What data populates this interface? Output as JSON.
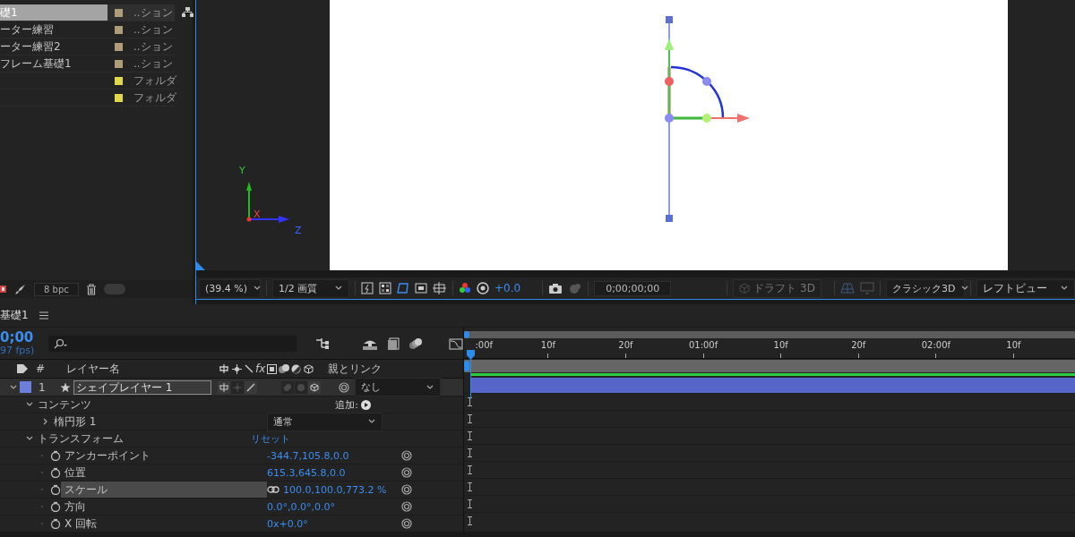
{
  "project": {
    "items": [
      {
        "name": "礎1",
        "type": "..ション",
        "color": "#b09c78",
        "selected": true
      },
      {
        "name": "ーター練習",
        "type": "..ション",
        "color": "#b09c78",
        "selected": false
      },
      {
        "name": "ーター練習2",
        "type": "..ション",
        "color": "#b09c78",
        "selected": false
      },
      {
        "name": "フレーム基礎1",
        "type": "..ション",
        "color": "#b09c78",
        "selected": false
      },
      {
        "type": "フォルダ",
        "color": "#e3d84a",
        "selected": false
      },
      {
        "type": "フォルダ",
        "color": "#e3d84a",
        "selected": false
      }
    ],
    "bit_depth": "8 bpc",
    "toggle_on": false
  },
  "viewer": {
    "axis_labels": [
      "Y",
      "X",
      "Z"
    ],
    "toolbar": {
      "zoom": "(39.4 %)",
      "resolution": "1/2 画質",
      "exposure": "+0.0",
      "timecode": "0;00;00;00",
      "draft_3d": {
        "label": "ドラフト 3D",
        "disabled": true
      },
      "renderer": "クラシック3D",
      "view": "レフトビュー"
    }
  },
  "timeline": {
    "tab": "基礎1",
    "current_time": "0;00",
    "fps": "97 fps)",
    "columns": {
      "number": "#",
      "layer_name": "レイヤー名",
      "fx": "fx",
      "parent": "親とリンク"
    },
    "layer": {
      "number": "1",
      "name": "シェイプレイヤー 1",
      "color": "#6b7fdb",
      "expanded": true,
      "parent": "なし",
      "switches": [
        {
          "kind": "shy",
          "on": true
        },
        {
          "kind": "collapse",
          "on": false
        },
        {
          "kind": "quality",
          "on": true
        },
        {
          "kind": "motion_blur",
          "on": false
        },
        {
          "kind": "adjustment",
          "on": false
        },
        {
          "kind": "cube",
          "on": true
        }
      ]
    },
    "properties": [
      {
        "name": "コンテンツ",
        "expanded": true,
        "add_label": "追加:",
        "children": [
          {
            "name": "楕円形 1",
            "expanded": false,
            "blend_mode": "通常"
          }
        ]
      },
      {
        "name": "トランスフォーム",
        "expanded": true,
        "reset_label": "リセット",
        "children": [
          {
            "name": "アンカーポイント",
            "value": "-344.7,105.8,0.0",
            "selected": false,
            "linked": false
          },
          {
            "name": "位置",
            "value": "615.3,645.8,0.0",
            "selected": false,
            "linked": false
          },
          {
            "name": "スケール",
            "value": "100.0,100.0,773.2 %",
            "selected": true,
            "linked": true
          },
          {
            "name": "方向",
            "value": "0.0°,0.0°,0.0°",
            "selected": false,
            "linked": false
          },
          {
            "name": "X 回転",
            "value": "0x+0.0°",
            "selected": false,
            "linked": false
          }
        ]
      }
    ],
    "ruler": [
      ":00f",
      "10f",
      "20f",
      "01:00f",
      "10f",
      "20f",
      "02:00f",
      "10f"
    ]
  }
}
